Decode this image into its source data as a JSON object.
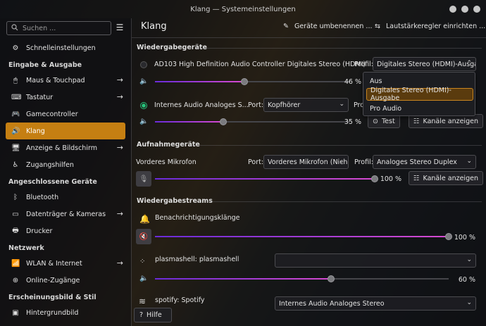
{
  "window": {
    "title": "Klang — Systemeinstellungen"
  },
  "sidebar": {
    "search_placeholder": "Suchen ...",
    "items": [
      {
        "label": "Schnelleinstellungen",
        "icon": "settings-icon"
      },
      {
        "section": "Eingabe & Ausgabe"
      },
      {
        "label": "Maus & Touchpad",
        "icon": "mouse-icon",
        "arrow": true
      },
      {
        "label": "Tastatur",
        "icon": "keyboard-icon",
        "arrow": true
      },
      {
        "label": "Gamecontroller",
        "icon": "gamepad-icon"
      },
      {
        "label": "Klang",
        "icon": "speaker-icon",
        "active": true
      },
      {
        "label": "Anzeige & Bildschirm",
        "icon": "monitor-icon",
        "arrow": true
      },
      {
        "label": "Zugangshilfen",
        "icon": "accessibility-icon"
      },
      {
        "section": "Angeschlossene Geräte"
      },
      {
        "label": "Bluetooth",
        "icon": "bluetooth-icon"
      },
      {
        "label": "Datenträger & Kameras",
        "icon": "drive-icon",
        "arrow": true
      },
      {
        "label": "Drucker",
        "icon": "printer-icon"
      },
      {
        "section": "Netzwerk"
      },
      {
        "label": "WLAN & Internet",
        "icon": "wifi-icon",
        "arrow": true
      },
      {
        "label": "Online-Zugänge",
        "icon": "online-accounts-icon"
      },
      {
        "section": "Erscheinungsbild & Stil"
      },
      {
        "label": "Hintergrundbild",
        "icon": "wallpaper-icon"
      }
    ]
  },
  "header": {
    "title": "Klang",
    "rename_label": "Geräte umbenennen ...",
    "volume_label": "Lautstärkeregler einrichten ..."
  },
  "playback": {
    "section_title": "Wiedergabegeräte",
    "device1": {
      "name": "AD103 High Definition Audio Controller Digitales Stereo (HDMI)",
      "profile_label": "Profil:",
      "profile_value": "Digitales Stereo (HDMI)-Ausgabe",
      "volume": 46,
      "volume_text": "46 %"
    },
    "device2": {
      "name": "Internes Audio Analoges S...",
      "port_label": "Port:",
      "port_value": "Kopfhörer",
      "profile_label": "Pro",
      "volume": 35,
      "volume_text": "35 %",
      "test_label": "Test",
      "channels_label": "Kanäle anzeigen"
    },
    "profile_popup": {
      "options": [
        "Aus",
        "Digitales Stereo (HDMI)-Ausgabe",
        "Pro Audio"
      ],
      "selected": 1
    }
  },
  "capture": {
    "section_title": "Aufnahmegeräte",
    "device1": {
      "name": "Vorderes Mikrofon",
      "port_label": "Port:",
      "port_value": "Vorderes Mikrofon (Nich",
      "profile_label": "Profil:",
      "profile_value": "Analoges Stereo Duplex",
      "volume": 100,
      "volume_text": "100 %",
      "channels_label": "Kanäle anzeigen"
    }
  },
  "streams": {
    "section_title": "Wiedergabestreams",
    "items": [
      {
        "name": "Benachrichtigungsklänge",
        "volume": 100,
        "volume_text": "100 %"
      },
      {
        "name": "plasmashell: plasmashell",
        "device_value": "",
        "volume": 60,
        "volume_text": "60 %"
      },
      {
        "name": "spotify: Spotify",
        "device_value": "Internes Audio Analoges Stereo"
      }
    ]
  },
  "help_label": "Hilfe"
}
